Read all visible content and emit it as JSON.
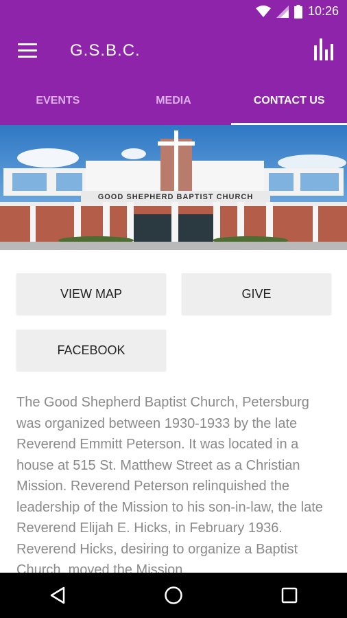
{
  "status_bar": {
    "time": "10:26"
  },
  "app_bar": {
    "title": "G.S.B.C."
  },
  "tabs": [
    {
      "label": "EVENTS"
    },
    {
      "label": "MEDIA"
    },
    {
      "label": "CONTACT US"
    }
  ],
  "hero": {
    "sign_text": "GOOD SHEPHERD BAPTIST CHURCH"
  },
  "actions": {
    "view_map": "VIEW MAP",
    "give": "GIVE",
    "facebook": "FACEBOOK"
  },
  "description": "The Good Shepherd Baptist Church, Petersburg was organized between 1930-1933 by the late Reverend Emmitt Peterson. It was located in a house at 515 St. Matthew Street as a Christian Mission. Reverend Peterson relinquished the leadership of the Mission to his son-in-law, the late Reverend Elijah E. Hicks, in February 1936. Reverend Hicks, desiring to organize a Baptist Church, moved the Mission",
  "colors": {
    "primary": "#8e24aa",
    "tab_inactive": "#ddb0ea",
    "button_bg": "#eeeeee",
    "body_text": "#8a8a8a"
  }
}
